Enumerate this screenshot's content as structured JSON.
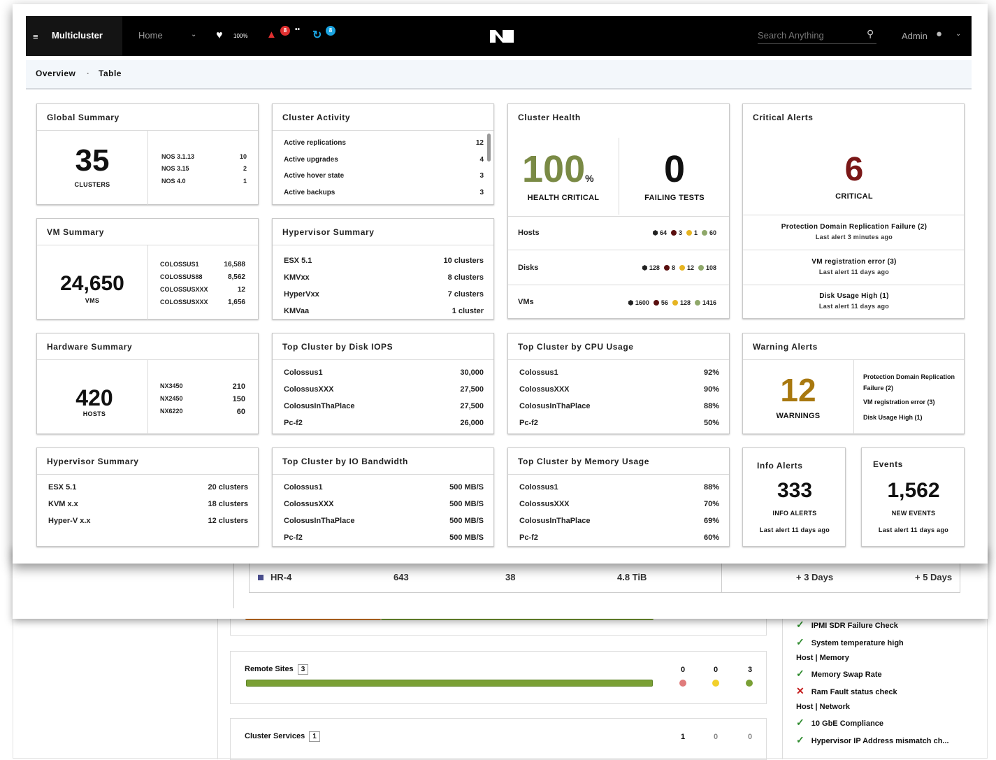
{
  "topbar": {
    "app_title": "Multicluster",
    "home_label": "Home",
    "health_value": "100%",
    "alerts_count": "8",
    "tasks_count": "8",
    "search_placeholder": "Search Anything",
    "user_label": "Admin",
    "brand_colors": {
      "bar": "#000000",
      "alert": "#e03030",
      "task": "#1aa3e0"
    }
  },
  "subnav": {
    "overview": "Overview",
    "table": "Table"
  },
  "global_summary": {
    "title": "Global Summary",
    "value": "35",
    "unit": "CLUSTERS",
    "rows": [
      {
        "label": "NOS 3.1.13",
        "value": "10"
      },
      {
        "label": "NOS 3.15",
        "value": "2"
      },
      {
        "label": "NOS 4.0",
        "value": "1"
      }
    ]
  },
  "cluster_activity": {
    "title": "Cluster Activity",
    "rows": [
      {
        "label": "Active replications",
        "value": "12"
      },
      {
        "label": "Active upgrades",
        "value": "4"
      },
      {
        "label": "Active hover state",
        "value": "3"
      },
      {
        "label": "Active backups",
        "value": "3"
      }
    ]
  },
  "cluster_health": {
    "title": "Cluster Health",
    "health_value": "100",
    "health_unit": "%",
    "health_label": "HEALTH CRITICAL",
    "failing_value": "0",
    "failing_label": "FAILING TESTS",
    "rows": [
      {
        "label": "Hosts",
        "total": "64",
        "critical": "3",
        "warning": "1",
        "ok": "60"
      },
      {
        "label": "Disks",
        "total": "128",
        "critical": "8",
        "warning": "12",
        "ok": "108"
      },
      {
        "label": "VMs",
        "total": "1600",
        "critical": "56",
        "warning": "128",
        "ok": "1416"
      }
    ],
    "colors": {
      "critical": "#5a0f0f",
      "warning": "#e6b422",
      "ok": "#8fa86a",
      "big": "#7a8a45"
    }
  },
  "critical_alerts": {
    "title": "Critical Alerts",
    "value": "6",
    "label": "CRITICAL",
    "color": "#7a1717",
    "items": [
      {
        "title": "Protection Domain Replication Failure (2)",
        "sub": "Last alert 3 minutes ago"
      },
      {
        "title": "VM registration error (3)",
        "sub": "Last alert 11 days ago"
      },
      {
        "title": "Disk Usage High (1)",
        "sub": "Last alert 11 days ago"
      }
    ]
  },
  "vm_summary": {
    "title": "VM Summary",
    "value": "24,650",
    "unit": "VMS",
    "rows": [
      {
        "label": "COLOSSUS1",
        "value": "16,588"
      },
      {
        "label": "COLOSSUS88",
        "value": "8,562"
      },
      {
        "label": "COLOSSUSXXX",
        "value": "12"
      },
      {
        "label": "COLOSSUSXXX",
        "value": "1,656"
      }
    ]
  },
  "hypervisor_summary_a": {
    "title": "Hypervisor Summary",
    "rows": [
      {
        "label": "ESX 5.1",
        "value": "10 clusters"
      },
      {
        "label": "KMVxx",
        "value": "8 clusters"
      },
      {
        "label": "HyperVxx",
        "value": "7 clusters"
      },
      {
        "label": "KMVaa",
        "value": "1 cluster"
      }
    ]
  },
  "hardware_summary": {
    "title": "Hardware Summary",
    "value": "420",
    "unit": "HOSTS",
    "rows": [
      {
        "label": "NX3450",
        "value": "210"
      },
      {
        "label": "NX2450",
        "value": "150"
      },
      {
        "label": "NX6220",
        "value": "60"
      }
    ]
  },
  "top_disk_iops": {
    "title": "Top Cluster by Disk IOPS",
    "rows": [
      {
        "label": "Colossus1",
        "value": "30,000"
      },
      {
        "label": "ColossusXXX",
        "value": "27,500"
      },
      {
        "label": "ColosusInThaPlace",
        "value": "27,500"
      },
      {
        "label": "Pc-f2",
        "value": "26,000"
      }
    ]
  },
  "top_cpu": {
    "title": "Top Cluster by CPU Usage",
    "rows": [
      {
        "label": "Colossus1",
        "value": "92%"
      },
      {
        "label": "ColossusXXX",
        "value": "90%"
      },
      {
        "label": "ColosusInThaPlace",
        "value": "88%"
      },
      {
        "label": "Pc-f2",
        "value": "50%"
      }
    ]
  },
  "warning_alerts": {
    "title": "Warning Alerts",
    "value": "12",
    "label": "WARNINGS",
    "color": "#a8780f",
    "items": [
      "Protection Domain Replication Failure (2)",
      "VM registration error (3)",
      "Disk Usage High (1)"
    ]
  },
  "hypervisor_summary_b": {
    "title": "Hypervisor Summary",
    "rows": [
      {
        "label": "ESX 5.1",
        "value": "20 clusters"
      },
      {
        "label": "KVM x.x",
        "value": "18 clusters"
      },
      {
        "label": "Hyper-V x.x",
        "value": "12 clusters"
      }
    ]
  },
  "top_io_bw": {
    "title": "Top Cluster by IO Bandwidth",
    "rows": [
      {
        "label": "Colossus1",
        "value": "500 MB/S"
      },
      {
        "label": "ColossusXXX",
        "value": "500 MB/S"
      },
      {
        "label": "ColosusInThaPlace",
        "value": "500 MB/S"
      },
      {
        "label": "Pc-f2",
        "value": "500 MB/S"
      }
    ]
  },
  "top_memory": {
    "title": "Top Cluster by Memory Usage",
    "rows": [
      {
        "label": "Colossus1",
        "value": "88%"
      },
      {
        "label": "ColossusXXX",
        "value": "70%"
      },
      {
        "label": "ColosusInThaPlace",
        "value": "69%"
      },
      {
        "label": "Pc-f2",
        "value": "60%"
      }
    ]
  },
  "info_alerts": {
    "title": "Info Alerts",
    "value": "333",
    "label": "INFO ALERTS",
    "sub": "Last alert 11 days ago"
  },
  "events": {
    "title": "Events",
    "value": "1,562",
    "label": "NEW EVENTS",
    "sub": "Last alert 11 days ago"
  },
  "background_table": {
    "row": {
      "name": "HR-4",
      "c1": "643",
      "c2": "38",
      "c3": "4.8 TiB",
      "c4": "+ 3 Days",
      "c5": "+ 5 Days"
    }
  },
  "background_health": {
    "remote_sites": {
      "label": "Remote Sites",
      "count": "3",
      "critical": "0",
      "warning": "0",
      "ok": "3",
      "progress_ok": 1.0
    },
    "cluster_services": {
      "label": "Cluster Services",
      "count": "1",
      "critical": "1",
      "warning": "0",
      "ok": "0"
    },
    "checks": {
      "item1": "IPMI SDR Failure Check",
      "item2": "System temperature high",
      "group_memory": "Host | Memory",
      "item3": "Memory Swap Rate",
      "item4": "Ram Fault status check",
      "group_network": "Host | Network",
      "item5": "10 GbE Compliance",
      "item6": "Hypervisor IP Address mismatch ch..."
    }
  }
}
